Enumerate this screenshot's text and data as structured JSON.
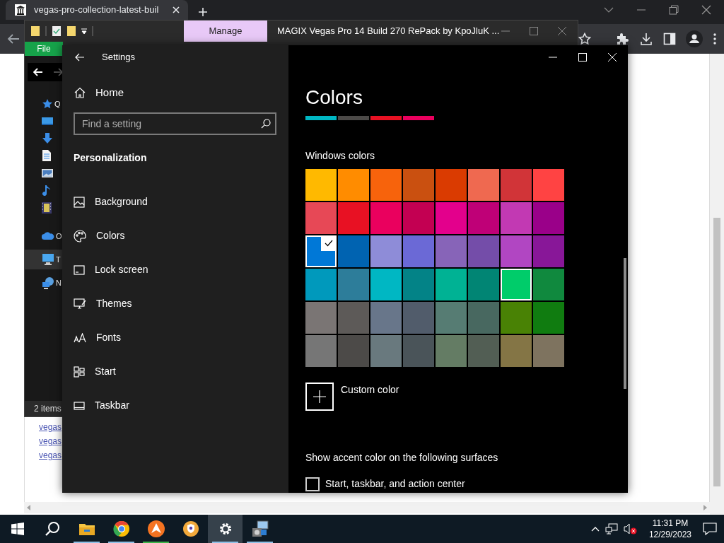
{
  "browser": {
    "tab_title": "vegas-pro-collection-latest-buil",
    "page_links": [
      "vegas",
      "vegas",
      "vegas"
    ]
  },
  "explorer": {
    "ribbon_tab": "Manage",
    "title": "MAGIX Vegas Pro 14 Build 270 RePack by KpoJluK ...",
    "file_tab": "File",
    "nav_items": [
      {
        "kind": "star",
        "label": "Q",
        "selected": false
      },
      {
        "kind": "desktop",
        "selected": false
      },
      {
        "kind": "download",
        "selected": false
      },
      {
        "kind": "document",
        "selected": false
      },
      {
        "kind": "pictures",
        "selected": false
      },
      {
        "kind": "music",
        "selected": false
      },
      {
        "kind": "videos",
        "selected": false
      },
      {
        "kind": "cloud",
        "label": "O",
        "selected": false
      },
      {
        "kind": "pc",
        "label": "T",
        "selected": true
      },
      {
        "kind": "network",
        "label": "N",
        "selected": false
      }
    ],
    "status": "2 items"
  },
  "settings": {
    "title": "Settings",
    "home": "Home",
    "search": {
      "placeholder": "Find a setting"
    },
    "section": "Personalization",
    "nav": [
      {
        "kind": "background",
        "label": "Background"
      },
      {
        "kind": "colors",
        "label": "Colors"
      },
      {
        "kind": "lock",
        "label": "Lock screen"
      },
      {
        "kind": "themes",
        "label": "Themes"
      },
      {
        "kind": "fonts",
        "label": "Fonts"
      },
      {
        "kind": "start",
        "label": "Start"
      },
      {
        "kind": "taskbar",
        "label": "Taskbar"
      }
    ],
    "heading": "Colors",
    "accent_preview": [
      {
        "color": "#00b7c3"
      },
      {
        "color": "#4c4a48"
      },
      {
        "color": "#e81123"
      },
      {
        "color": "#ea005e"
      }
    ],
    "windows_colors_label": "Windows colors",
    "swatches": [
      {
        "color": "#ffb900",
        "selected": false,
        "hovered": false
      },
      {
        "color": "#ff8c00",
        "selected": false,
        "hovered": false
      },
      {
        "color": "#f7630c",
        "selected": false,
        "hovered": false
      },
      {
        "color": "#ca5010",
        "selected": false,
        "hovered": false
      },
      {
        "color": "#da3b01",
        "selected": false,
        "hovered": false
      },
      {
        "color": "#ef6950",
        "selected": false,
        "hovered": false
      },
      {
        "color": "#d13438",
        "selected": false,
        "hovered": false
      },
      {
        "color": "#ff4343",
        "selected": false,
        "hovered": false
      },
      {
        "color": "#e74856",
        "selected": false,
        "hovered": false
      },
      {
        "color": "#e81123",
        "selected": false,
        "hovered": false
      },
      {
        "color": "#ea005e",
        "selected": false,
        "hovered": false
      },
      {
        "color": "#c30052",
        "selected": false,
        "hovered": false
      },
      {
        "color": "#e3008c",
        "selected": false,
        "hovered": false
      },
      {
        "color": "#bf0077",
        "selected": false,
        "hovered": false
      },
      {
        "color": "#c239b3",
        "selected": false,
        "hovered": false
      },
      {
        "color": "#9a0089",
        "selected": false,
        "hovered": false
      },
      {
        "color": "#0078d7",
        "selected": true,
        "hovered": false
      },
      {
        "color": "#0063b1",
        "selected": false,
        "hovered": false
      },
      {
        "color": "#8e8cd8",
        "selected": false,
        "hovered": false
      },
      {
        "color": "#6b69d6",
        "selected": false,
        "hovered": false
      },
      {
        "color": "#8764b8",
        "selected": false,
        "hovered": false
      },
      {
        "color": "#744da9",
        "selected": false,
        "hovered": false
      },
      {
        "color": "#b146c2",
        "selected": false,
        "hovered": false
      },
      {
        "color": "#881798",
        "selected": false,
        "hovered": false
      },
      {
        "color": "#0099bc",
        "selected": false,
        "hovered": false
      },
      {
        "color": "#2d7d9a",
        "selected": false,
        "hovered": false
      },
      {
        "color": "#00b7c3",
        "selected": false,
        "hovered": false
      },
      {
        "color": "#038387",
        "selected": false,
        "hovered": false
      },
      {
        "color": "#00b294",
        "selected": false,
        "hovered": false
      },
      {
        "color": "#018574",
        "selected": false,
        "hovered": false
      },
      {
        "color": "#00cc6a",
        "selected": false,
        "hovered": true
      },
      {
        "color": "#10893e",
        "selected": false,
        "hovered": false
      },
      {
        "color": "#7a7574",
        "selected": false,
        "hovered": false
      },
      {
        "color": "#5d5a58",
        "selected": false,
        "hovered": false
      },
      {
        "color": "#68768a",
        "selected": false,
        "hovered": false
      },
      {
        "color": "#515c6b",
        "selected": false,
        "hovered": false
      },
      {
        "color": "#567c73",
        "selected": false,
        "hovered": false
      },
      {
        "color": "#486860",
        "selected": false,
        "hovered": false
      },
      {
        "color": "#498205",
        "selected": false,
        "hovered": false
      },
      {
        "color": "#107c10",
        "selected": false,
        "hovered": false
      },
      {
        "color": "#767676",
        "selected": false,
        "hovered": false
      },
      {
        "color": "#4c4a48",
        "selected": false,
        "hovered": false
      },
      {
        "color": "#69797e",
        "selected": false,
        "hovered": false
      },
      {
        "color": "#4a5459",
        "selected": false,
        "hovered": false
      },
      {
        "color": "#647c64",
        "selected": false,
        "hovered": false
      },
      {
        "color": "#525e54",
        "selected": false,
        "hovered": false
      },
      {
        "color": "#847545",
        "selected": false,
        "hovered": false
      },
      {
        "color": "#7e735f",
        "selected": false,
        "hovered": false
      }
    ],
    "custom_color": "Custom color",
    "surfaces_label": "Show accent color on the following surfaces",
    "surfaces": [
      {
        "label": "Start, taskbar, and action center",
        "checked": false
      }
    ]
  },
  "taskbar": {
    "apps": [
      {
        "kind": "start",
        "running": false,
        "active": false
      },
      {
        "kind": "search",
        "running": false,
        "active": false
      },
      {
        "kind": "folder",
        "running": true,
        "active": false
      },
      {
        "kind": "chrome",
        "running": true,
        "active": false
      },
      {
        "kind": "avast",
        "running": true,
        "active": false
      },
      {
        "kind": "shield",
        "running": false,
        "active": false
      },
      {
        "kind": "gear",
        "running": true,
        "active": true
      },
      {
        "kind": "installer",
        "running": true,
        "active": false
      }
    ],
    "time": "11:31 PM",
    "date": "12/29/2023"
  }
}
